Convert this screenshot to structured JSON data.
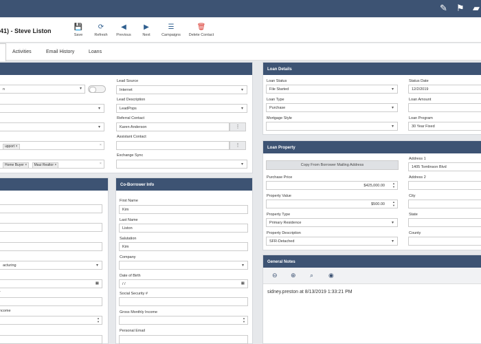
{
  "header": {
    "title": "41) - Steve Liston",
    "icons": {
      "pen": "✎",
      "flag": "⚑",
      "chat": "▰"
    }
  },
  "toolbar": {
    "save": {
      "label": "Save",
      "icon": "💾"
    },
    "refresh": {
      "label": "Refresh",
      "icon": "⟳"
    },
    "previous": {
      "label": "Previous",
      "icon": "◀"
    },
    "next": {
      "label": "Next",
      "icon": "▶"
    },
    "campaigns": {
      "label": "Campaigns",
      "icon": "☰"
    },
    "delete": {
      "label": "Delete Contact",
      "icon": "🗑"
    }
  },
  "tabs": [
    "Activities",
    "Email History",
    "Loans"
  ],
  "contact_panel": {
    "field1": "n",
    "tags1": [
      "upport"
    ],
    "tags2": [
      "Home Buyer",
      "Maui Realtor"
    ],
    "lead_source": {
      "label": "Lead Source",
      "value": "Internet"
    },
    "lead_description": {
      "label": "Lead Description",
      "value": "LeadPops"
    },
    "referral_contact": {
      "label": "Referral Contact",
      "value": "Karen Anderson"
    },
    "assistant_contact": {
      "label": "Assistant Contact",
      "value": ""
    },
    "exchange_sync": {
      "label": "Exchange Sync",
      "value": ""
    },
    "dots": "⋮",
    "clear": "×"
  },
  "borrower_panel": {
    "industry_value": "acturing",
    "income_label": "ncome",
    "income_partial": "r"
  },
  "coborrower": {
    "title": "Co-Borrower Info",
    "first_name": {
      "label": "First Name",
      "value": "Kim"
    },
    "last_name": {
      "label": "Last Name",
      "value": "Liston"
    },
    "salutation": {
      "label": "Salutation",
      "value": "Kim"
    },
    "company": {
      "label": "Company",
      "value": ""
    },
    "dob": {
      "label": "Date of Birth",
      "value": "/ /"
    },
    "ssn": {
      "label": "Social Security #",
      "value": ""
    },
    "income": {
      "label": "Gross Monthly Income",
      "value": ""
    },
    "email": {
      "label": "Personal Email",
      "value": ""
    }
  },
  "loan_details": {
    "title": "Loan Details",
    "loan_status": {
      "label": "Loan Status",
      "value": "File Started"
    },
    "loan_type": {
      "label": "Loan Type",
      "value": "Purchase"
    },
    "mortgage_style": {
      "label": "Mortgage Style",
      "value": ""
    },
    "status_date": {
      "label": "Status Date",
      "value": "12/2/2019"
    },
    "loan_amount": {
      "label": "Loan Amount",
      "value": ""
    },
    "loan_program": {
      "label": "Loan Program",
      "value": "30 Year Fixed"
    }
  },
  "loan_property": {
    "title": "Loan Property",
    "copy_button": "Copy From Borrower Mailing Address",
    "purchase_price": {
      "label": "Purchase Price",
      "value": "$425,000.00"
    },
    "property_value": {
      "label": "Property Value",
      "value": "$500.00"
    },
    "property_type": {
      "label": "Property Type",
      "value": "Primary Residence"
    },
    "property_description": {
      "label": "Property Description",
      "value": "SFR-Detached"
    },
    "address1": {
      "label": "Address 1",
      "value": "1405 Tomlinson Blvd"
    },
    "address2": {
      "label": "Address 2",
      "value": ""
    },
    "city": {
      "label": "City",
      "value": ""
    },
    "state": {
      "label": "State",
      "value": ""
    },
    "county": {
      "label": "County",
      "value": ""
    }
  },
  "general_notes": {
    "title": "General Notes",
    "icons": {
      "minus": "⊖",
      "plus": "⊕",
      "search": "⌕",
      "user": "◉"
    },
    "note": "sidney.preston at 8/13/2019 1:33:21 PM"
  },
  "glyphs": {
    "calendar": "▦",
    "up": "▲",
    "down": "▼"
  },
  "colors": {
    "header_bg": "#3d5373",
    "save_green": "#2e8b3e",
    "delete_red": "#d9342b",
    "nav_blue": "#2f5f8f"
  }
}
